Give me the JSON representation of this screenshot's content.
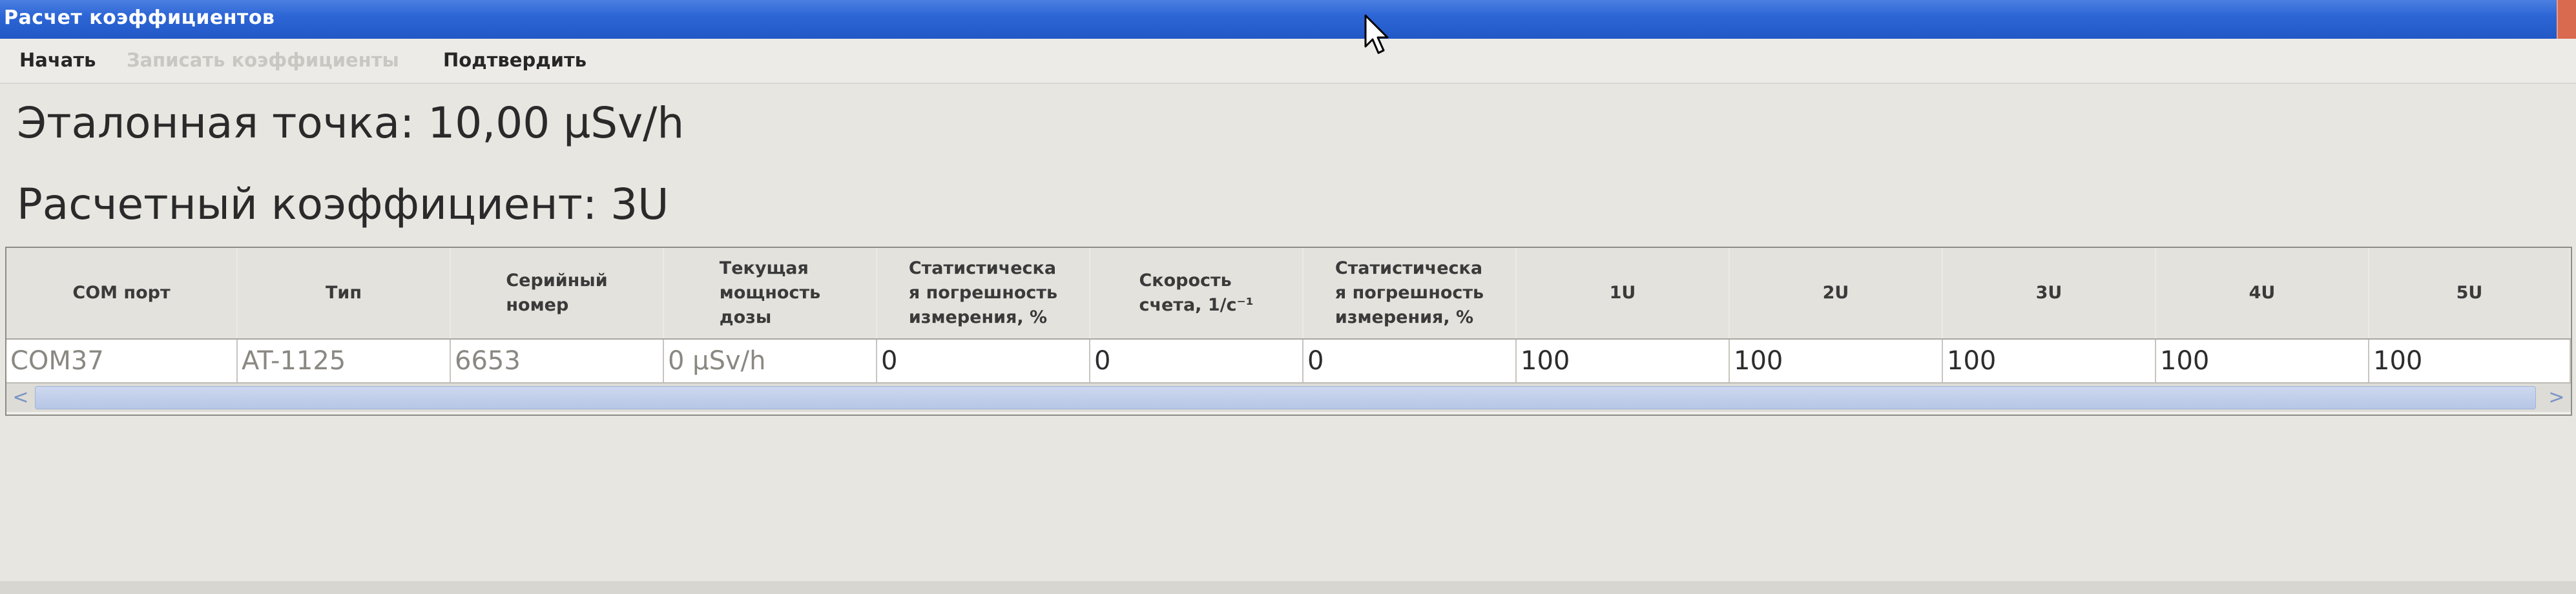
{
  "window": {
    "title": "Расчет коэффициентов"
  },
  "menu": {
    "start": "Начать",
    "write_coefficients": "Записать коэффициенты",
    "confirm": "Подтвердить"
  },
  "info": {
    "reference_point": "Эталонная точка: 10,00 µSv/h",
    "computed_coefficient": "Расчетный коэффициент: 3U"
  },
  "table": {
    "columns": [
      [
        "COM порт"
      ],
      [
        "Тип"
      ],
      [
        "Серийный",
        "номер"
      ],
      [
        "Текущая",
        "мощность",
        "дозы"
      ],
      [
        "Статистическа",
        "я погрешность",
        "измерения, %"
      ],
      [
        "Скорость",
        "счета, 1/c⁻¹"
      ],
      [
        "Статистическа",
        "я погрешность",
        "измерения, %"
      ],
      [
        "1U"
      ],
      [
        "2U"
      ],
      [
        "3U"
      ],
      [
        "4U"
      ],
      [
        "5U"
      ]
    ],
    "rows": [
      [
        "COM37",
        "AT-1125",
        "6653",
        "0 µSv/h",
        "0",
        "0",
        "0",
        "100",
        "100",
        "100",
        "100",
        "100"
      ]
    ]
  },
  "scrollbar": {
    "left_arrow": "<",
    "right_arrow": ">"
  },
  "colors": {
    "title_bar": "#2d66d6",
    "window_bg": "#e7e6e1",
    "scroll_thumb": "#b6c6e6"
  },
  "icons": [
    "mouse-pointer-icon",
    "scroll-left-icon",
    "scroll-right-icon",
    "close-icon"
  ]
}
